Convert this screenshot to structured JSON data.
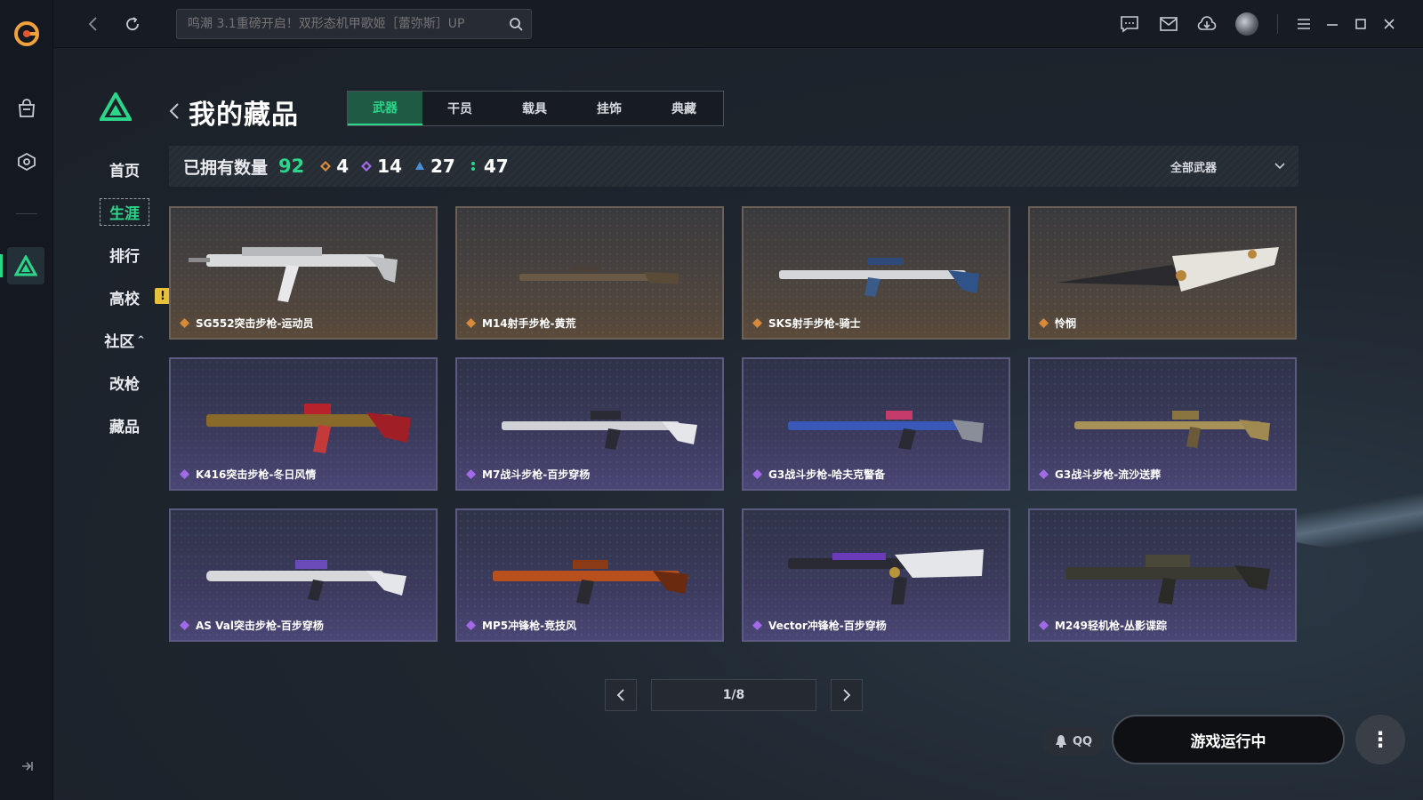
{
  "topbar": {
    "search_placeholder": "鸣潮 3.1重磅开启！双形态机甲歌姬［蕾弥斯］UP"
  },
  "sidebar": {
    "items": [
      {
        "label": "首页"
      },
      {
        "label": "生涯"
      },
      {
        "label": "排行"
      },
      {
        "label": "高校"
      },
      {
        "label": "社区"
      },
      {
        "label": "改枪"
      },
      {
        "label": "藏品"
      }
    ],
    "community_caret": "^",
    "campus_badge": "!"
  },
  "page": {
    "title": "我的藏品",
    "tabs": [
      {
        "label": "武器"
      },
      {
        "label": "干员"
      },
      {
        "label": "载具"
      },
      {
        "label": "挂饰"
      },
      {
        "label": "典藏"
      }
    ]
  },
  "stats": {
    "owned_label": "已拥有数量",
    "total": "92",
    "gold": "4",
    "purple": "14",
    "blue": "27",
    "green": "47",
    "filter_label": "全部武器",
    "colors": {
      "gold": "#d8893a",
      "purple": "#a26ae8",
      "blue": "#4a90d8",
      "green": "#2bd68a"
    }
  },
  "items": [
    {
      "name": "SG552突击步枪-运动员",
      "rarity": "gold"
    },
    {
      "name": "M14射手步枪-黄荒",
      "rarity": "gold"
    },
    {
      "name": "SKS射手步枪-骑士",
      "rarity": "gold"
    },
    {
      "name": "怜悯",
      "rarity": "gold"
    },
    {
      "name": "K416突击步枪-冬日风情",
      "rarity": "purple"
    },
    {
      "name": "M7战斗步枪-百步穿杨",
      "rarity": "purple"
    },
    {
      "name": "G3战斗步枪-哈夫克警备",
      "rarity": "purple"
    },
    {
      "name": "G3战斗步枪-流沙送葬",
      "rarity": "purple"
    },
    {
      "name": "AS Val突击步枪-百步穿杨",
      "rarity": "purple"
    },
    {
      "name": "MP5冲锋枪-竞技风",
      "rarity": "purple"
    },
    {
      "name": "Vector冲锋枪-百步穿杨",
      "rarity": "purple"
    },
    {
      "name": "M249轻机枪-丛影谍踪",
      "rarity": "purple"
    }
  ],
  "pager": {
    "label": "1/8"
  },
  "footer": {
    "qq_label": "QQ",
    "run_label": "游戏运行中",
    "more_label": "⋮"
  }
}
